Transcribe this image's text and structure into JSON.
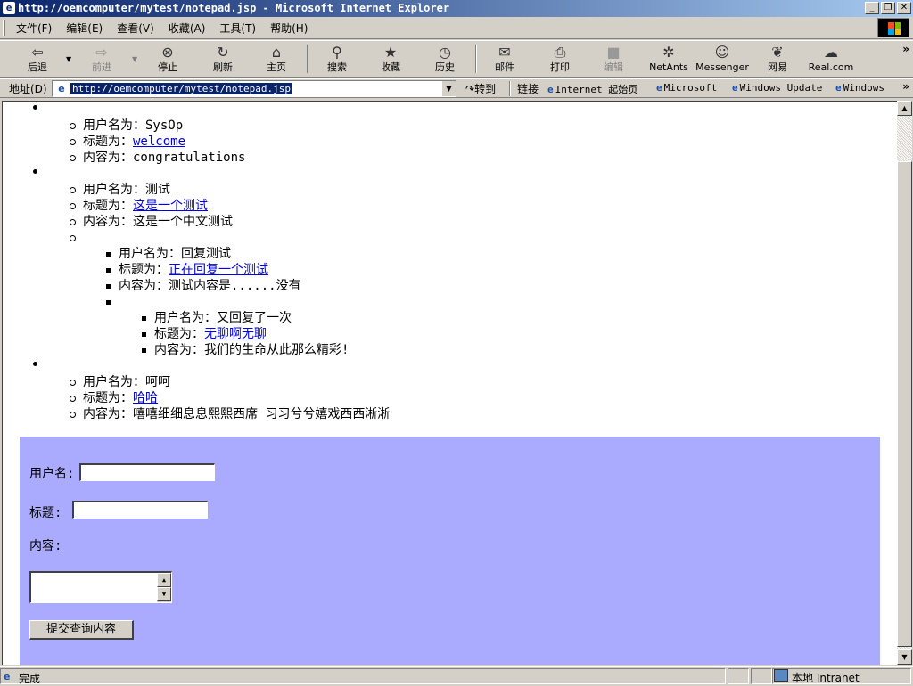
{
  "window": {
    "title": "http://oemcomputer/mytest/notepad.jsp - Microsoft Internet Explorer",
    "controls": [
      "_",
      "❐",
      "✕"
    ]
  },
  "menu": [
    "文件(F)",
    "编辑(E)",
    "查看(V)",
    "收藏(A)",
    "工具(T)",
    "帮助(H)"
  ],
  "toolbar": {
    "back": "后退",
    "forward": "前进",
    "stop": "停止",
    "refresh": "刷新",
    "home": "主页",
    "search": "搜索",
    "favorites": "收藏",
    "history": "历史",
    "mail": "邮件",
    "print": "打印",
    "edit": "编辑",
    "netants": "NetAnts",
    "messenger": "Messenger",
    "netease": "网易",
    "real": "Real.com"
  },
  "address": {
    "label": "地址(D)",
    "url": "http://oemcomputer/mytest/notepad.jsp",
    "go": "转到",
    "links_label": "链接",
    "links": [
      "Internet 起始页",
      "Microsoft",
      "Windows Update",
      "Windows"
    ]
  },
  "posts": [
    {
      "user_label": "用户名为：",
      "user": "SysOp",
      "title_label": "标题为：",
      "title": "welcome",
      "content_label": "内容为：",
      "content": "congratulations"
    },
    {
      "user_label": "用户名为：",
      "user": "测试",
      "title_label": "标题为：",
      "title": "这是一个测试",
      "content_label": "内容为：",
      "content": "这是一个中文测试",
      "reply": {
        "user_label": "用户名为：",
        "user": "回复测试",
        "title_label": "标题为：",
        "title": "正在回复一个测试",
        "content_label": "内容为：",
        "content": "测试内容是......没有",
        "reply": {
          "user_label": "用户名为：",
          "user": "又回复了一次",
          "title_label": "标题为：",
          "title": "无聊啊无聊",
          "content_label": "内容为：",
          "content": "我们的生命从此那么精彩!"
        }
      }
    },
    {
      "user_label": "用户名为：",
      "user": "呵呵",
      "title_label": "标题为：",
      "title": "哈哈",
      "content_label": "内容为：",
      "content": "嘻嘻细细息息熙熙西席 习习兮兮嬉戏西西淅淅"
    }
  ],
  "form": {
    "username_label": "用户名:",
    "title_label": "标题:",
    "content_label": "内容:",
    "submit": "提交查询内容",
    "panel_color": "#aaaaff"
  },
  "status": {
    "text": "完成",
    "zone": "本地 Intranet"
  }
}
